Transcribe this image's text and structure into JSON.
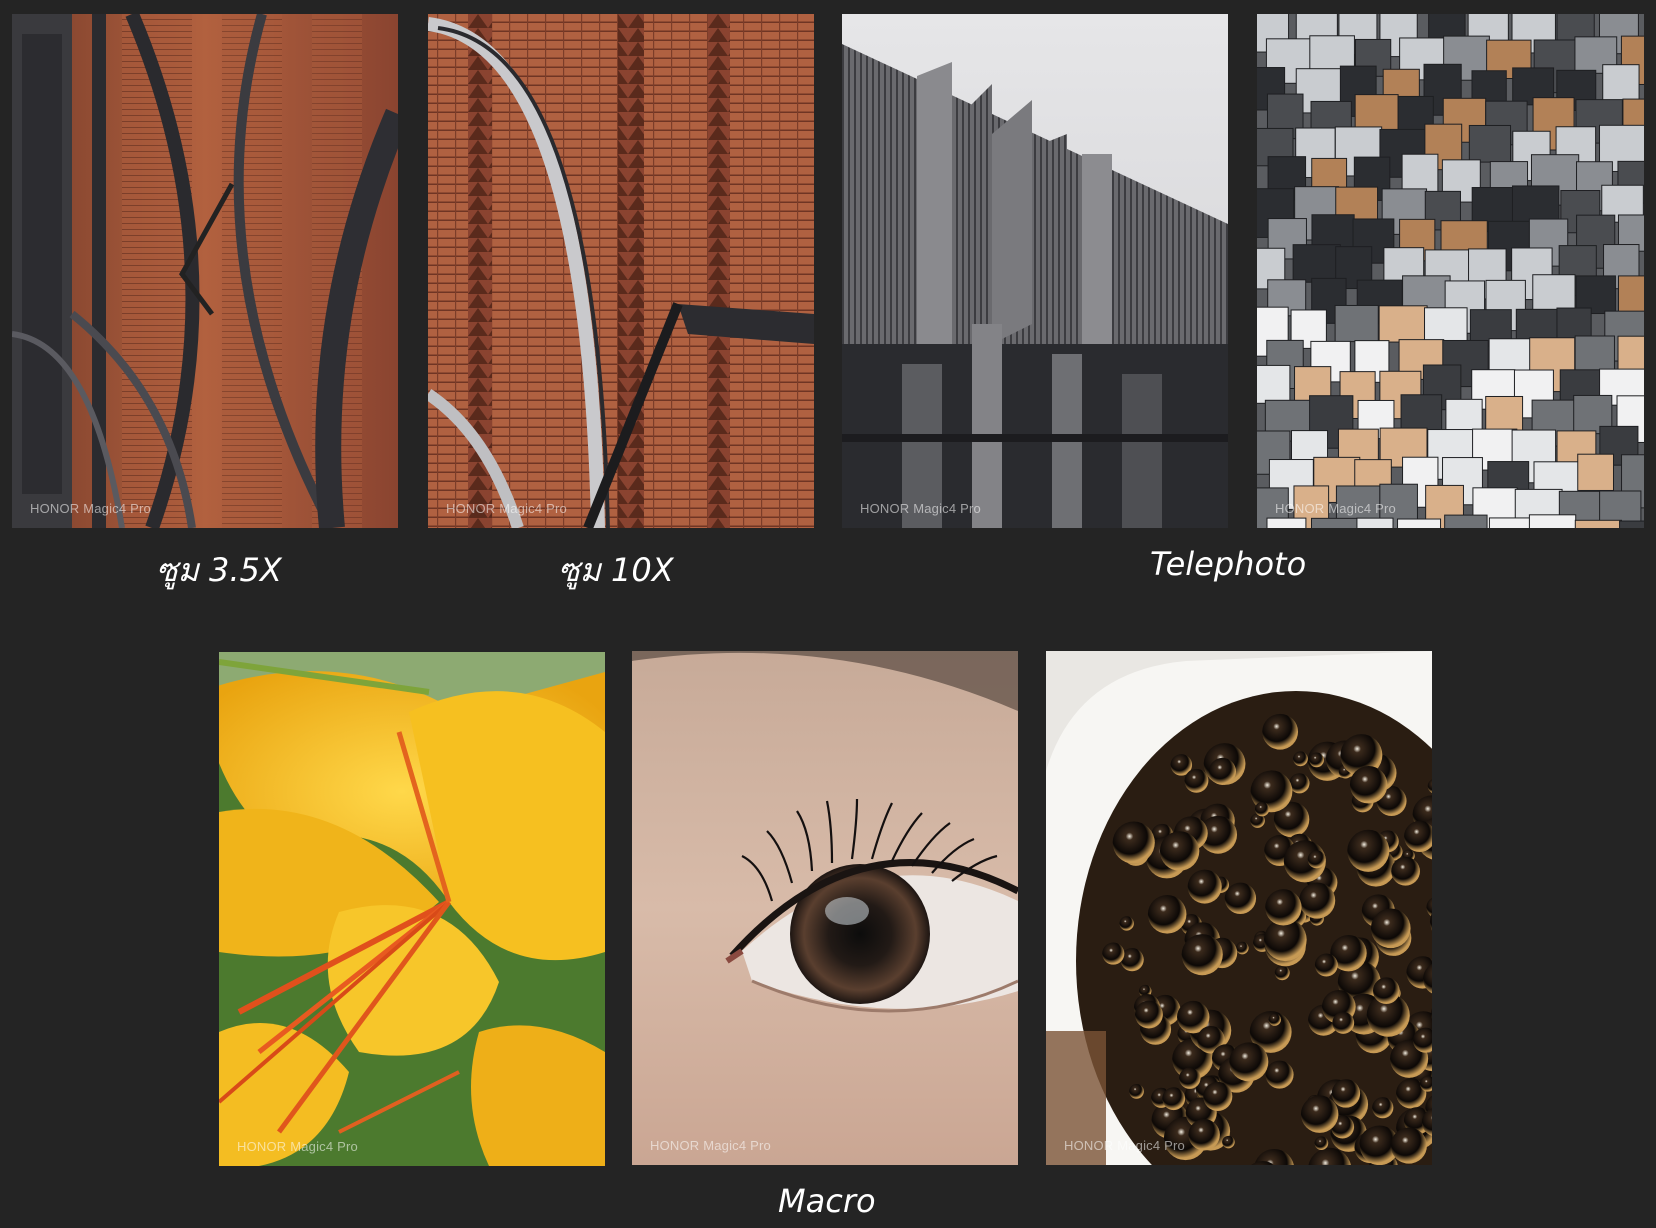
{
  "watermark": "HONOR Magic4 Pro",
  "captions": {
    "zoom_35": "ซูม 3.5X",
    "zoom_10": "ซูม 10X",
    "telephoto": "Telephoto",
    "macro": "Macro"
  },
  "colors": {
    "background": "#242424",
    "brick": "#a4563c",
    "yellow_flower": "#f2b31b",
    "coffee": "#1e140c"
  }
}
